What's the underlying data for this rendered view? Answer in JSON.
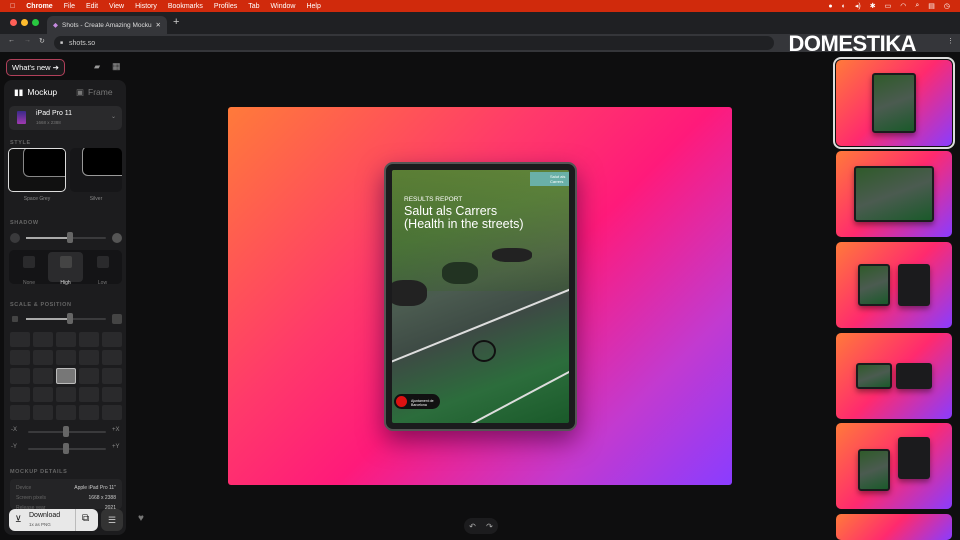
{
  "menubar": {
    "app": "Chrome",
    "items": [
      "File",
      "Edit",
      "View",
      "History",
      "Bookmarks",
      "Profiles",
      "Tab",
      "Window",
      "Help"
    ]
  },
  "browser": {
    "tab_title": "Shots - Create Amazing Mockups",
    "url": "shots.so"
  },
  "watermark": "DOMESTIKA",
  "sidebar": {
    "whats_new": "What's new ➔",
    "tabs": {
      "mockup": "Mockup",
      "frame": "Frame"
    },
    "device": {
      "name": "iPad Pro 11",
      "resolution": "1668 x 2388"
    },
    "style_label": "STYLE",
    "styles": [
      "Space Grey",
      "Silver"
    ],
    "shadow_label": "SHADOW",
    "shadow_level": 0.55,
    "shadow_options": [
      "None",
      "High",
      "Low"
    ],
    "scale_label": "SCALE & POSITION",
    "scale_level": 0.55,
    "x_labels": [
      "-X",
      "+X"
    ],
    "y_labels": [
      "-Y",
      "+Y"
    ],
    "details_label": "MOCKUP DETAILS",
    "details": [
      {
        "k": "Device",
        "v": "Apple iPad Pro 11\""
      },
      {
        "k": "Screen pixels",
        "v": "1668 x 2388"
      },
      {
        "k": "Release year",
        "v": "2021"
      }
    ],
    "download": {
      "label": "Download",
      "sub": "1x as PNG"
    }
  },
  "cover": {
    "kicker": "RESULTS REPORT",
    "title": "Salut als Carrers (Health in the streets)",
    "badge": "Salut als Carrers",
    "footer": "Ajuntament de Barcelona"
  }
}
